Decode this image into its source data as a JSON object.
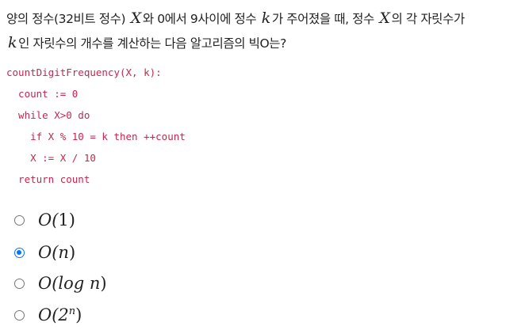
{
  "question": {
    "seg1": "양의 정수(32비트 정수) ",
    "var_x1": "X",
    "seg2": "와 0에서 9사이에 정수 ",
    "var_k1": "k",
    "seg3": "가 주어졌을 때, 정수 ",
    "var_x2": "X",
    "seg4": "의 각 자릿수가 ",
    "var_k2": "k",
    "seg5": "인 자릿수의 개수를 계산하는 다음 알고리즘의 빅O는?"
  },
  "code": {
    "lines": [
      "countDigitFrequency(X, k):",
      "  count := 0",
      "  while X>0 do",
      "    if X % 10 = k then ++count",
      "    X := X / 10",
      "  return count"
    ],
    "color": "#c7254e"
  },
  "options": [
    {
      "pre": "O(",
      "var": "",
      "mid": "1",
      "sup": "",
      "post": ")",
      "selected": false
    },
    {
      "pre": "O(",
      "var": "n",
      "mid": "",
      "sup": "",
      "post": ")",
      "selected": true
    },
    {
      "pre": "O(log ",
      "var": "n",
      "mid": "",
      "sup": "",
      "post": ")",
      "selected": false
    },
    {
      "pre": "O(2",
      "var": "",
      "mid": "",
      "sup": "n",
      "post": ")",
      "selected": false
    }
  ],
  "colors": {
    "radio_selected": "#0075ff",
    "text": "#222222"
  }
}
